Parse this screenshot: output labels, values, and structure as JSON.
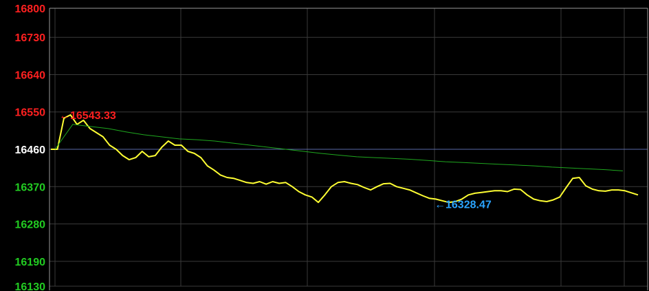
{
  "chart_data": {
    "type": "line",
    "ylim": [
      16130,
      16800
    ],
    "y_ticks": [
      {
        "value": 16800,
        "label": "16800",
        "color": "#ff2020"
      },
      {
        "value": 16730,
        "label": "16730",
        "color": "#ff2020"
      },
      {
        "value": 16640,
        "label": "16640",
        "color": "#ff2020"
      },
      {
        "value": 16550,
        "label": "16550",
        "color": "#ff2020"
      },
      {
        "value": 16460,
        "label": "16460",
        "color": "#ffffff"
      },
      {
        "value": 16370,
        "label": "16370",
        "color": "#22cc22"
      },
      {
        "value": 16280,
        "label": "16280",
        "color": "#22cc22"
      },
      {
        "value": 16190,
        "label": "16190",
        "color": "#22cc22"
      },
      {
        "value": 16130,
        "label": "16130",
        "color": "#22cc22"
      }
    ],
    "reference_value": 16460,
    "grid": true,
    "series": [
      {
        "color": "#ffff33",
        "values": [
          16460,
          16460,
          16535,
          16543,
          16520,
          16530,
          16510,
          16500,
          16490,
          16470,
          16460,
          16445,
          16435,
          16440,
          16455,
          16442,
          16445,
          16465,
          16480,
          16470,
          16470,
          16455,
          16450,
          16440,
          16420,
          16410,
          16398,
          16392,
          16390,
          16385,
          16380,
          16378,
          16382,
          16376,
          16382,
          16378,
          16380,
          16370,
          16358,
          16350,
          16345,
          16332,
          16350,
          16370,
          16380,
          16382,
          16378,
          16375,
          16368,
          16362,
          16370,
          16377,
          16378,
          16370,
          16366,
          16362,
          16355,
          16348,
          16342,
          16340,
          16336,
          16332,
          16334,
          16340,
          16350,
          16354,
          16356,
          16358,
          16360,
          16360,
          16358,
          16364,
          16363,
          16350,
          16340,
          16336,
          16334,
          16338,
          16345,
          16368,
          16390,
          16392,
          16372,
          16364,
          16360,
          16359,
          16362,
          16362,
          16360,
          16355,
          16350
        ]
      },
      {
        "color": "#1fa81f",
        "values": [
          16460,
          16520,
          16515,
          16510,
          16502,
          16495,
          16490,
          16485,
          16483,
          16480,
          16475,
          16470,
          16465,
          16460,
          16455,
          16450,
          16446,
          16442,
          16440,
          16438,
          16436,
          16433,
          16430,
          16428,
          16426,
          16424,
          16422,
          16420,
          16417,
          16415,
          16413,
          16411,
          16408
        ]
      }
    ],
    "annotations": [
      {
        "text": "16543.33",
        "arrow": "←",
        "value": 16543.33,
        "color": "#ff2020"
      },
      {
        "text": "16328.47",
        "arrow": "←",
        "value": 16328.47,
        "color": "#2aa4ff"
      }
    ]
  }
}
